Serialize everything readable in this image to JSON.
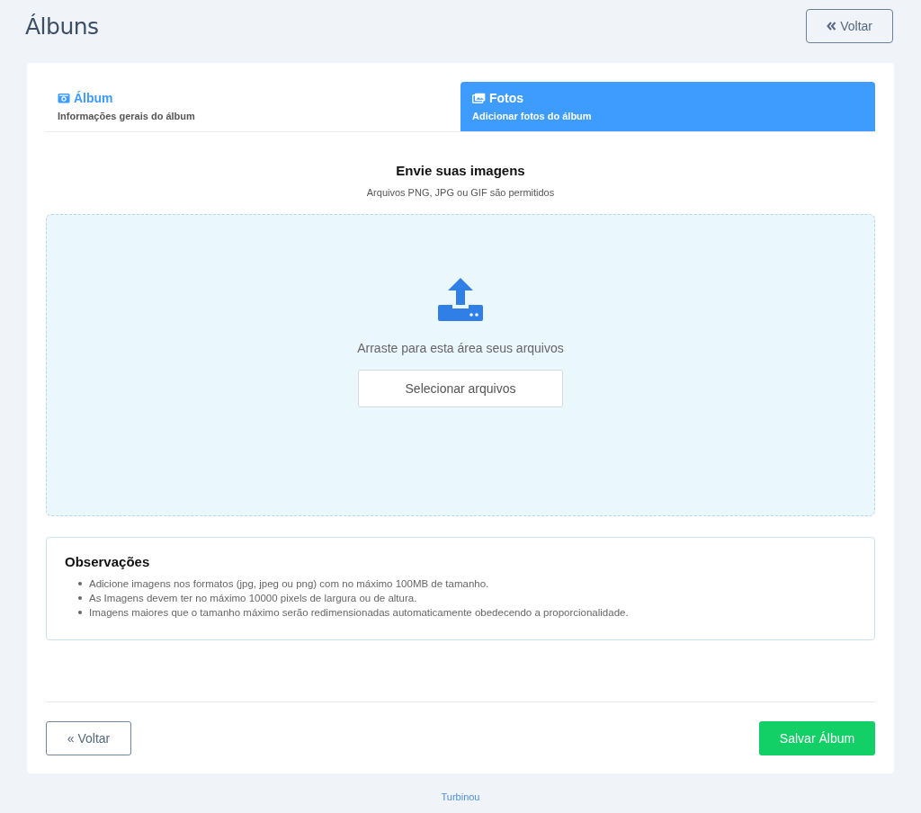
{
  "header": {
    "title": "Álbuns",
    "back_button": "Voltar"
  },
  "tabs": [
    {
      "title": "Álbum",
      "subtitle": "Informações gerais do álbum",
      "selected": false
    },
    {
      "title": "Fotos",
      "subtitle": "Adicionar fotos do álbum",
      "selected": true
    }
  ],
  "upload": {
    "title": "Envie suas imagens",
    "hint": "Arquivos PNG, JPG ou GIF são permitidos",
    "drop_text": "Arraste para esta área seus arquivos",
    "select_button": "Selecionar arquivos"
  },
  "notes": {
    "title": "Observações",
    "items": [
      "Adicione imagens nos formatos (jpg, jpeg ou png) com no máximo 100MB de tamanho.",
      "As Imagens devem ter no máximo 10000 pixels de largura ou de altura.",
      "Imagens maiores que o tamanho máximo serão redimensionadas automaticamente obedecendo a proporcionalidade."
    ]
  },
  "footer_buttons": {
    "back": "« Voltar",
    "save": "Salvar Álbum"
  },
  "footer": "Turbinou"
}
